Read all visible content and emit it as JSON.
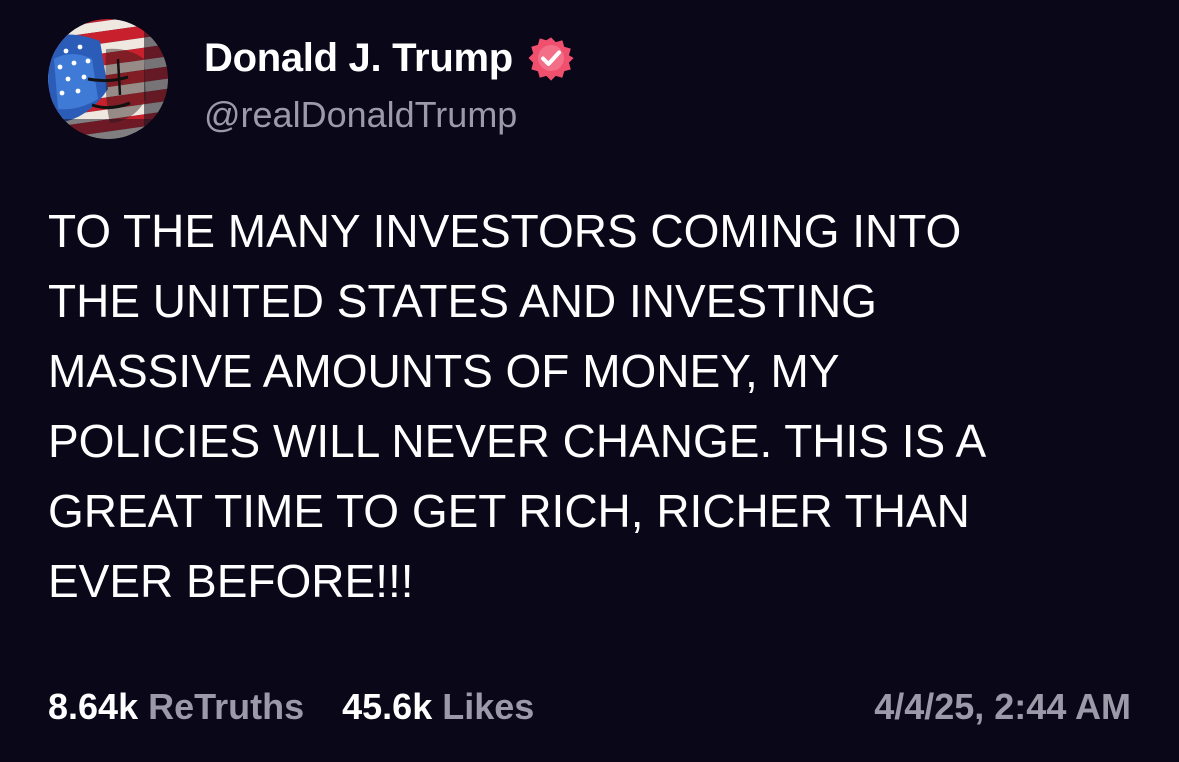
{
  "author": {
    "display_name": "Donald J. Trump",
    "handle": "@realDonaldTrump",
    "verified": true,
    "avatar_icon": "flag-portrait-avatar",
    "verified_icon": "verified-badge-icon"
  },
  "post": {
    "lines": [
      "TO THE MANY INVESTORS COMING INTO",
      "THE UNITED STATES AND INVESTING",
      "MASSIVE AMOUNTS OF MONEY, MY",
      "POLICIES WILL NEVER CHANGE. THIS IS A",
      "GREAT TIME TO GET RICH, RICHER THAN",
      "EVER BEFORE!!!"
    ]
  },
  "stats": {
    "retruths_count": "8.64k",
    "retruths_label": "ReTruths",
    "likes_count": "45.6k",
    "likes_label": "Likes"
  },
  "timestamp": "4/4/25, 2:44 AM",
  "colors": {
    "background": "#0a0718",
    "text_primary": "#ffffff",
    "text_secondary": "#9c9aa8",
    "verified_badge": "#f0506e"
  }
}
